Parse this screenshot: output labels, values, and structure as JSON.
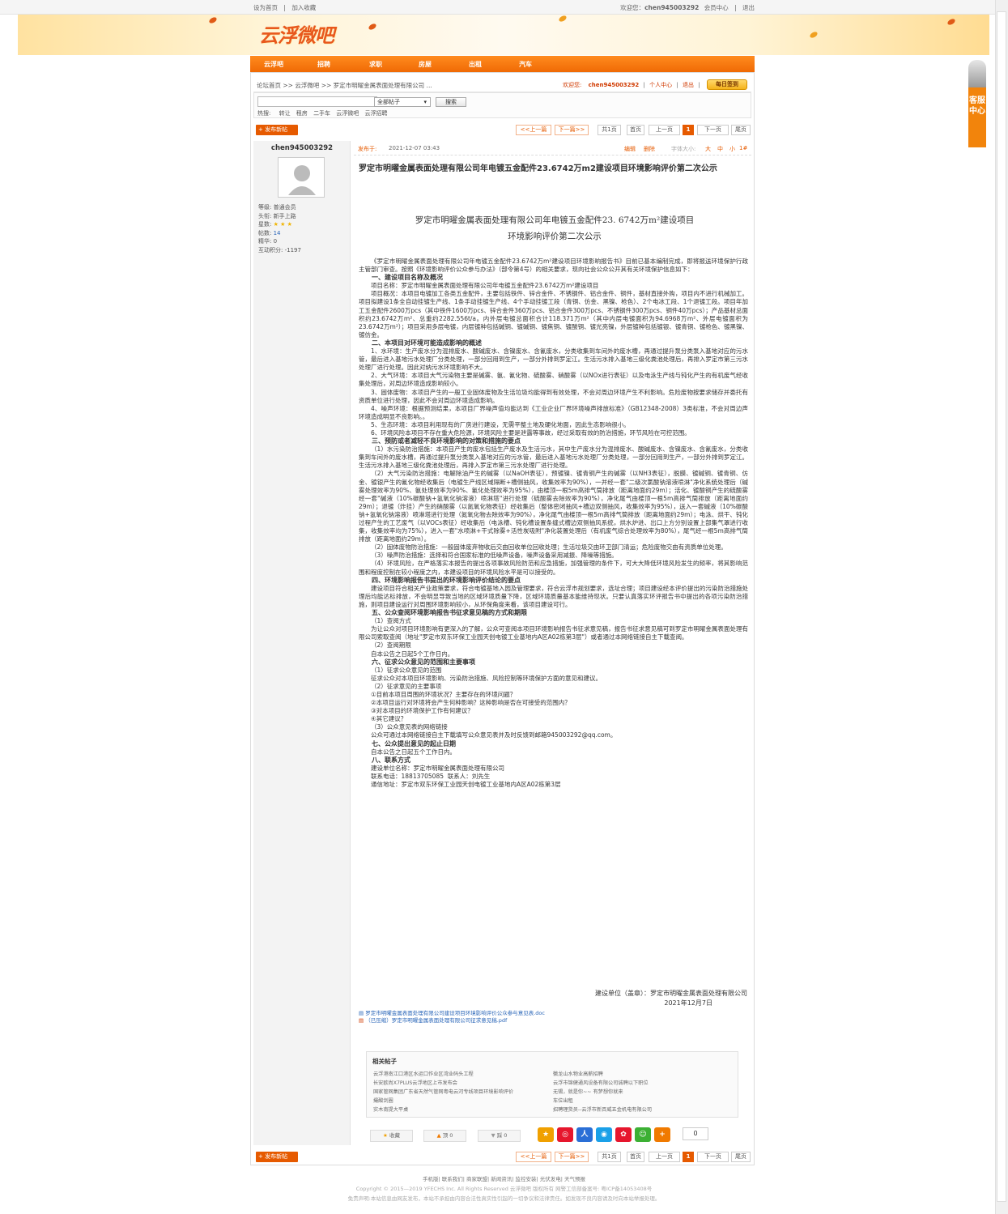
{
  "topbar": {
    "set_home": "设为首页",
    "sep": "|",
    "add_fav": "加入收藏",
    "welcome": "欢迎您：",
    "user": "chen945003292",
    "member": "会员中心",
    "logout": "退出"
  },
  "logo": "云浮微吧",
  "nav": [
    "云浮吧",
    "招聘",
    "求职",
    "房屋",
    "出租",
    "汽车"
  ],
  "breadcrumb": {
    "path": "论坛首页 >> 云浮微吧 >> 罗定市明曜金属表面处理有限公司 ...",
    "welcome": "欢迎您:",
    "user": "chen945003292",
    "center": "个人中心",
    "logout": "退出",
    "signin": "每日签到"
  },
  "search": {
    "select": "全部帖子",
    "button": "搜索",
    "hot_label": "热搜:",
    "hot": [
      "转让",
      "租房",
      "二手车",
      "云浮微吧",
      "云浮招聘"
    ]
  },
  "post_button": "发布新帖",
  "pager": {
    "prev": "<<上一篇",
    "next": "下一篇>>",
    "total": "共1页",
    "first": "首页",
    "prev_page": "上一页",
    "current": "1",
    "next_page": "下一页",
    "last": "尾页"
  },
  "author": {
    "name": "chen945003292",
    "level_label": "等级:",
    "level": "普通会员",
    "title_label": "头衔:",
    "title": "新手上路",
    "stars_label": "星数:",
    "stars": "3",
    "posts_label": "帖数:",
    "posts": "14",
    "elite_label": "精华:",
    "elite": "0",
    "points_label": "互动积分:",
    "points": "-1197"
  },
  "post_meta": {
    "label": "发布于:",
    "date": "2021-12-07 03:43",
    "edit": "编辑",
    "delete": "删除",
    "fontsize": "字体大小:",
    "big": "大",
    "mid": "中",
    "small": "小",
    "floor": "1#"
  },
  "post_title": "罗定市明曜金属表面处理有限公司年电镀五金配件23.6742万m2建设项目环境影响评价第二次公示",
  "doc_title_1": "罗定市明曜金属表面处理有限公司年电镀五金配件23. 6742万m²建设项目",
  "doc_title_2": "环境影响评价第二次公示",
  "paragraphs": [
    {
      "h": false,
      "t": "《罗定市明曜金属表面处理有限公司年电镀五金配件23.6742万m²建设项目环境影响报告书》目前已基本编制完成，即将报送环境保护行政主管部门审查。按照《环境影响评价公众参与办法》（部令第4号）的相关要求，现向社会公众公开其有关环境保护信息如下："
    },
    {
      "h": true,
      "t": "一、建设项目名称及概况"
    },
    {
      "h": false,
      "t": "项目名称：罗定市明曜金属表面处理有限公司年电镀五金配件23.6742万m²建设项目"
    },
    {
      "h": false,
      "t": "项目概况：本项目电镀加工各类五金配件，主要包括铁件、锌合金件、不锈钢件、铝合金件、铜件，基材直接外购，项目内不进行机械加工。项目拟建设1条全自动挂镀生产线、1条手动挂镀生产线、4个手动挂镀工段（青铜、仿金、黑镍、枪色）、2个电冰工段、1个退镀工段。项目年加工五金配件2600万pcs（其中铁件1600万pcs、锌合金件360万pcs、铝合金件300万pcs、不锈钢件300万pcs、铜件40万pcs）；产品基材总面积约23.6742万m²、总重约2282.556t/a。内外层电镀总面积合计118.371万m²（其中内层电镀面积为94.6968万m²、外层电镀面积为23.6742万m²）；项目采用多层电镀，内层镀种包括碱铜、镀碱铜、镀焦铜、镀酸铜、镀光亮镍，外层镀种包括镀银、镀青铜、镀枪色、镀黑镍、镀仿金。"
    },
    {
      "h": true,
      "t": "二、本项目对环境可能造成影响的概述"
    },
    {
      "h": false,
      "t": "1、水环境：生产废水分为混排废水、酸碱废水、含镍废水、含氰废水，分类收集到车间外的废水槽，再通过提升泵分类泵入基地对应的污水管，最后进入基地污水处理厂分类处理，一部分回用到生产，一部分外排到罗定江。生活污水排入基地三级化粪池处理后，再排入罗定市第三污水处理厂进行处理。因此对纳污水环境影响不大。"
    },
    {
      "h": false,
      "t": "2、大气环境：本项目大气污染物主要是碱雾、氨、氰化物、硫酸雾、硝酸雾（以NOx进行表征）以及电泳生产线与钝化产生的有机废气经收集处理后，对周边环境造成影响较小。"
    },
    {
      "h": false,
      "t": "3、固体废物：本项目产生的一般工业固体废物及生活垃圾均能得到有效处理，不会对周边环境产生不利影响。危险废物按要求储存并委托有资质单位进行处理，因此不会对周边环境造成影响。"
    },
    {
      "h": false,
      "t": "4、噪声环境：根据预测结果，本项目厂界噪声值均能达到《工业企业厂界环境噪声排放标准》（GB12348-2008）3类标准，不会对周边声环境造成明显不良影响。。"
    },
    {
      "h": false,
      "t": "5、生态环境：本项目利用现有的厂房进行建设，无需平整土地及硬化地面，因此生态影响很小。"
    },
    {
      "h": false,
      "t": "6、环境风险本项目不存在重大危险源，环境风险主要是泄露等事故，经过采取有效的防治措施，环节风险在可控范围。"
    },
    {
      "h": true,
      "t": "三、预防或者减轻不良环境影响的对策和措施的要点"
    },
    {
      "h": false,
      "t": "（1）水污染防治措施：本项目产生的废水包括生产废水及生活污水，其中生产废水分为混排废水、酸碱废水、含镍废水、含氰废水，分类收集到车间外的废水槽，再通过提升泵分类泵入基地对应的污水管，最后进入基地污水处理厂分类处理，一部分回用到生产，一部分外排到罗定江。生活污水排入基地三级化粪池处理后，再排入罗定市第三污水处理厂进行处理。"
    },
    {
      "h": false,
      "t": "（2）大气污染防治措施：电解除油产生的碱雾（以NaOH表征），预镀镍、镀青铜产生的碱雾（以NH3表征），脱膜、镀碱铜、镀青铜、仿金、镀银产生的氰化物经收集后（电镀生产线区域隔断+槽侧抽风，收集效率为90%），一并经一套\"二级次氯酸钠溶液喷淋\"净化系统处理后（碱雾处理效率为90%、氨处理效率为90%、氰化处理效率为95%），由楼顶一根5m高排气筒排放（距离地面约29m）；活化、镀酸铜产生的硫酸雾经一套\"碱液（10%碳酸钠+氢氧化钠溶液）喷淋塔\"进行处理（硫酸雾去除效率为90%），净化尾气由楼顶一根5m高排气筒排放（距离地面约29m）；退镀（炸挂）产生的硝酸雾（以氮氧化物表征）经收集后（整体密闭抽风+槽边双侧抽风，收集效率为95%），送入一套碱液（10%碳酸钠+氢氧化钠溶液）喷淋塔进行处理（氮氧化物去除效率为90%），净化尾气由楼顶一根5m高排气筒排放（距离地面约29m）；电泳、烘干、钝化过程产生的工艺废气（以VOCs表征）经收集后（电泳槽、钝化槽设置条缝式槽边双侧抽风系统，烘水炉进、出口上方分别设置上部集气罩进行收集，收集效率均为75%），进入一套\"水喷淋+干式除雾+活性炭吸附\"净化装置处理后（有机废气综合处理效率为80%），尾气经一根5m高排气筒排放（距离地面约29m）。"
    },
    {
      "h": false,
      "t": "（2）固体废物防治措施：一般固体废弃物收后交由回收单位回收处理；生活垃圾交由环卫部门清运；危险废物交由有资质单位处理。"
    },
    {
      "h": false,
      "t": "（3）噪声防治措施：选择和符合国家标准的低噪声设备，噪声设备采用减振、降噪等措施。"
    },
    {
      "h": false,
      "t": "（4）环境风险，在严格落实本报告的提出各项事故风险防范和应急措施，加强管理的条件下，可大大降低环境风险发生的频率，将其影响范围和程度控制在较小程度之内，本建设项目的环境风险水平是可以接受的。"
    },
    {
      "h": true,
      "t": "四、环境影响报告书提出的环境影响评价结论的要点"
    },
    {
      "h": false,
      "t": "建设项目符合相关产业政策要求，符合电镀基地入园及管理要求，符合云浮市规划要求，选址合理；项目建设经本评价提出的污染防治措施处理后均能达标排放，不会明显导致当地的区域环境质量下降，区域环境质量基本能维持现状。只要认真落实环评报告书中提出的各项污染防治措施，则项目建设运行对周围环境影响较小，从环保角度来看，该项目建设可行。"
    },
    {
      "h": true,
      "t": "五、公众查阅环境影响报告书征求意见稿的方式和期限"
    },
    {
      "h": false,
      "t": "（1）查阅方式"
    },
    {
      "h": false,
      "t": "为让公众对项目环境影响有更深入的了解，公众可查阅本项目环境影响报告书征求意见稿，报告书征求意见稿可到罗定市明曜金属表面处理有限公司索取查阅（地址\"罗定市双东环保工业园天创电镀工业基地内A区A02栋第3层\"）或者通过本网络链接自主下载查阅。"
    },
    {
      "h": false,
      "t": "（2）查阅期限"
    },
    {
      "h": false,
      "t": "自本公告之日起5个工作日内。"
    },
    {
      "h": true,
      "t": "六、征求公众意见的范围和主要事项"
    },
    {
      "h": false,
      "t": "（1）征求公众意见的范围"
    },
    {
      "h": false,
      "t": "征求公众对本项目环境影响、污染防治措施、风险控制等环境保护方面的意见和建议。"
    },
    {
      "h": false,
      "t": "（2）征求意见的主要事项"
    },
    {
      "h": false,
      "t": "①目前本项目周围的环境状况？主要存在的环境问题？"
    },
    {
      "h": false,
      "t": "②本项目运行对环境将会产生何种影响？这种影响是否在可接受的范围内？"
    },
    {
      "h": false,
      "t": "③对本项目的环境保护工作有何建议？"
    },
    {
      "h": false,
      "t": "④其它建议？"
    },
    {
      "h": false,
      "t": "（3）公众意见表的网络链接"
    },
    {
      "h": false,
      "t": "公众可通过本网络链接自主下载填写公众意见表并及时反馈到邮箱945003292@qq.com。"
    },
    {
      "h": true,
      "t": "七、公众提出意见的起止日期"
    },
    {
      "h": false,
      "t": "自本公告之日起五个工作日内。"
    },
    {
      "h": true,
      "t": "八、联系方式"
    },
    {
      "h": false,
      "t": "建设单位名称：罗定市明曜金属表面处理有限公司"
    },
    {
      "h": false,
      "t": "联系电话：18813705085  联系人：刘先生"
    },
    {
      "h": false,
      "t": "通信地址：罗定市双东环保工业园天创电镀工业基地内A区A02栋第3层"
    }
  ],
  "signature": {
    "unit": "建设单位（盖章）：罗定市明曜金属表面处理有限公司",
    "date": "2021年12月7日"
  },
  "attachments": [
    "罗定市明曜金属表面处理有限公司建设项目环境影响评价公众参与意见表.doc",
    "（已压缩）罗定市明曜金属表面处理有限公司征求意见稿.pdf"
  ],
  "related": {
    "title": "相关帖子",
    "left": [
      "云浮港南江口港区水运口作业区湾业码头工程",
      "长安欧尚X7PLUS云浮地区上市发布会",
      "国家管网集团广东省天然气管网粤电云河专线项目环境影响评价",
      "撮酸剑圈",
      "实木南提大平桌"
    ],
    "right": [
      "徽龙山水物业高薪招聘",
      "云浮市锦健通风设备有限公司诚聘以下职位",
      "无锡，就是你~~ 有梦想你就来",
      "车位出租",
      "招聘理货员--云浮市新百威五金机电有限公司"
    ]
  },
  "actions": {
    "fav": "收藏",
    "up": "顶 0",
    "down": "踩 0",
    "count": "0"
  },
  "footer": {
    "links": "手机版| 联系我们| 商家联盟| 新闻资讯| 监控安装| 光伏发电| 天气预报",
    "copyright": "Copyright © 2015—2019 YFECHS Inc. All Rights Reserved 云浮微吧 版权所有 网警工信部备案号: 粤ICP备14053408号",
    "disclaimer": "免责声明:本站信息由网友发布，本站不承担由内容合法性真实性引起的一切争议和法律责任。如发现不良内容请及时向本站举报处理。"
  },
  "service": "客服中心"
}
